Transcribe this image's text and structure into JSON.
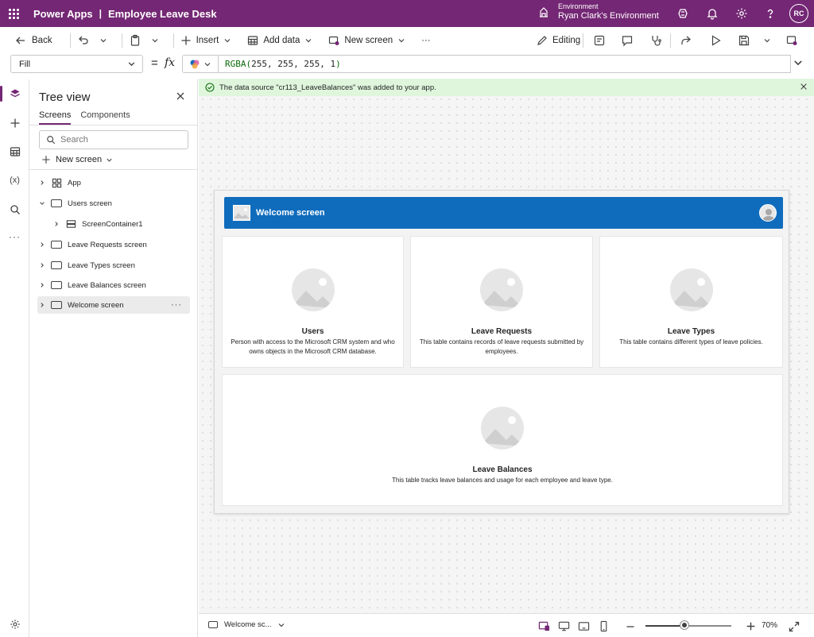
{
  "titlebar": {
    "product": "Power Apps",
    "separator": "|",
    "app_name": "Employee Leave Desk",
    "environment_label": "Environment",
    "environment_name": "Ryan Clark's Environment",
    "avatar_initials": "RC"
  },
  "commandbar": {
    "back": "Back",
    "insert": "Insert",
    "add_data": "Add data",
    "new_screen": "New screen",
    "more": "···",
    "editing": "Editing"
  },
  "formulabar": {
    "property": "Fill",
    "equals": "=",
    "fx": "fx",
    "formula_fn": "RGBA(",
    "formula_args": "255, 255, 255, 1",
    "formula_close": ")"
  },
  "notification": {
    "message": "The data source \"cr113_LeaveBalances\" was added to your app."
  },
  "tree": {
    "title": "Tree view",
    "tabs": [
      "Screens",
      "Components"
    ],
    "search_placeholder": "Search",
    "new_screen": "New screen",
    "items": [
      {
        "label": "App"
      },
      {
        "label": "Users screen"
      },
      {
        "label": "ScreenContainer1"
      },
      {
        "label": "Leave Requests screen"
      },
      {
        "label": "Leave Types screen"
      },
      {
        "label": "Leave Balances screen"
      },
      {
        "label": "Welcome screen"
      }
    ],
    "more": "···"
  },
  "canvas": {
    "header_title": "Welcome screen",
    "cards": [
      {
        "title": "Users",
        "description": "Person with access to the Microsoft CRM system and who owns objects in the Microsoft CRM database."
      },
      {
        "title": "Leave Requests",
        "description": "This table contains records of leave requests submitted by employees."
      },
      {
        "title": "Leave Types",
        "description": "This table contains different types of leave policies."
      },
      {
        "title": "Leave Balances",
        "description": "This table tracks leave balances and usage for each employee and leave type."
      }
    ]
  },
  "statusbar": {
    "screen_select": "Welcome sc...",
    "zoom": "70%",
    "zoom_level": 0.45
  },
  "colors": {
    "brand": "#742774",
    "header_blue": "#0f6cbd",
    "notif_bg": "#dff6dd"
  }
}
